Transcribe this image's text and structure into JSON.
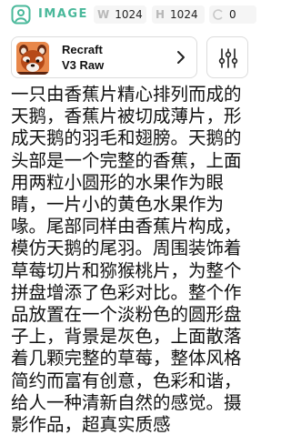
{
  "header": {
    "mode_label": "IMAGE",
    "width_key": "W",
    "width_value": "1024",
    "height_key": "H",
    "height_value": "1024",
    "seed_value": "0",
    "icons": {
      "mode": "image-icon",
      "seed": "seed-icon"
    },
    "accent_color": "#49b89a"
  },
  "model": {
    "name": "Recraft",
    "variant": "V3 Raw",
    "thumbnail": "red-panda-avatar",
    "chevron": "chevron-right-icon",
    "settings_icon": "sliders-icon"
  },
  "prompt": {
    "text": "一只由香蕉片精心排列而成的天鹅，香蕉片被切成薄片，形成天鹅的羽毛和翅膀。天鹅的头部是一个完整的香蕉，上面用两粒小圆形的水果作为眼睛，一片小的黄色水果作为喙。尾部同样由香蕉片构成，模仿天鹅的尾羽。周围装饰着草莓切片和猕猴桃片，为整个拼盘增添了色彩对比。整个作品放置在一个淡粉色的圆形盘子上，背景是灰色，上面散落着几颗完整的草莓，整体风格简约而富有创意，色彩和谐，给人一种清新自然的感觉。摄影作品，超真实质感"
  }
}
